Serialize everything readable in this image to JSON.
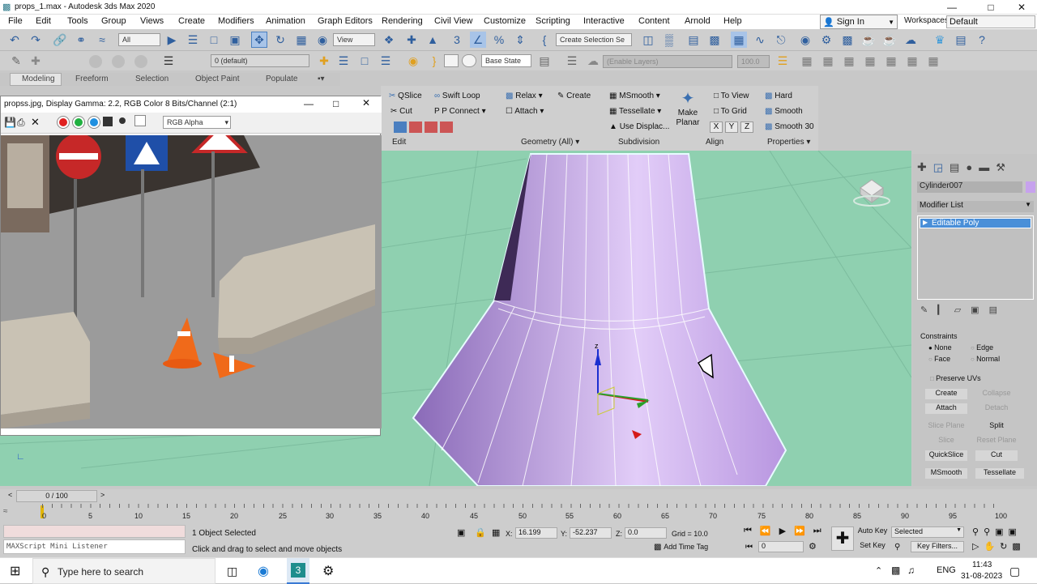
{
  "window": {
    "title": "props_1.max - Autodesk 3ds Max 2020"
  },
  "menu": [
    "File",
    "Edit",
    "Tools",
    "Group",
    "Views",
    "Create",
    "Modifiers",
    "Animation",
    "Graph Editors",
    "Rendering",
    "Civil View",
    "Customize",
    "Scripting",
    "Interactive",
    "Content",
    "Arnold",
    "Help"
  ],
  "account": {
    "signin": "Sign In",
    "workspaces_label": "Workspaces:",
    "workspace": "Default"
  },
  "toolbar": {
    "filter": "All",
    "ref_coord": "View",
    "selection_set": "Create Selection Se",
    "layer": "0 (default)",
    "state": "Base State",
    "layer_field": "(Enable Layers)",
    "num_field": "100.0"
  },
  "ribbon_tabs": [
    "Modeling",
    "Freeform",
    "Selection",
    "Object Paint",
    "Populate"
  ],
  "ribbon": {
    "edit": {
      "qslice": "QSlice",
      "swift_loop": "Swift Loop",
      "cut": "Cut",
      "p_connect": "P Connect",
      "title": "Edit"
    },
    "geometry": {
      "relax": "Relax",
      "create": "Create",
      "attach": "Attach",
      "title": "Geometry (All)"
    },
    "subdivision": {
      "msmooth": "MSmooth",
      "tessellate": "Tessellate",
      "use_displace": "Use Displac...",
      "title": "Subdivision"
    },
    "align": {
      "make_planar": "Make Planar",
      "to_view": "To View",
      "to_grid": "To Grid",
      "x": "X",
      "y": "Y",
      "z": "Z",
      "title": "Align"
    },
    "properties": {
      "hard": "Hard",
      "smooth": "Smooth",
      "smooth30": "Smooth 30",
      "title": "Properties"
    }
  },
  "render_frame": {
    "title": "propss.jpg, Display Gamma: 2.2, RGB Color 8 Bits/Channel (2:1)",
    "channel": "RGB Alpha"
  },
  "command_panel": {
    "object_name": "Cylinder007",
    "modifier_list": "Modifier List",
    "stack_item": "Editable Poly",
    "constraints_title": "Constraints",
    "none": "None",
    "edge": "Edge",
    "face": "Face",
    "normal": "Normal",
    "preserve_uvs": "Preserve UVs",
    "create": "Create",
    "collapse": "Collapse",
    "attach": "Attach",
    "detach": "Detach",
    "slice_plane": "Slice Plane",
    "split": "Split",
    "slice": "Slice",
    "reset_plane": "Reset Plane",
    "quickslice": "QuickSlice",
    "cut": "Cut",
    "msmooth": "MSmooth",
    "tessellate": "Tessellate"
  },
  "timeline": {
    "frame": "0 / 100",
    "ticks": [
      "0",
      "5",
      "10",
      "15",
      "20",
      "25",
      "30",
      "35",
      "40",
      "45",
      "50",
      "55",
      "60",
      "65",
      "70",
      "75",
      "80",
      "85",
      "90",
      "95",
      "100"
    ]
  },
  "status": {
    "listener": "MAXScript Mini Listener",
    "selected": "1 Object Selected",
    "hint": "Click and drag to select and move objects",
    "x_label": "X:",
    "x": "16.199",
    "y_label": "Y:",
    "y": "-52.237",
    "z_label": "Z:",
    "z": "0.0",
    "grid": "Grid = 10.0",
    "add_time_tag": "Add Time Tag",
    "auto_key": "Auto Key",
    "set_key": "Set Key",
    "key_mode": "Selected",
    "key_filters": "Key Filters...",
    "frame_field": "0"
  },
  "taskbar": {
    "search": "Type here to search",
    "lang": "ENG",
    "time": "11:43",
    "date": "31-08-2023"
  }
}
